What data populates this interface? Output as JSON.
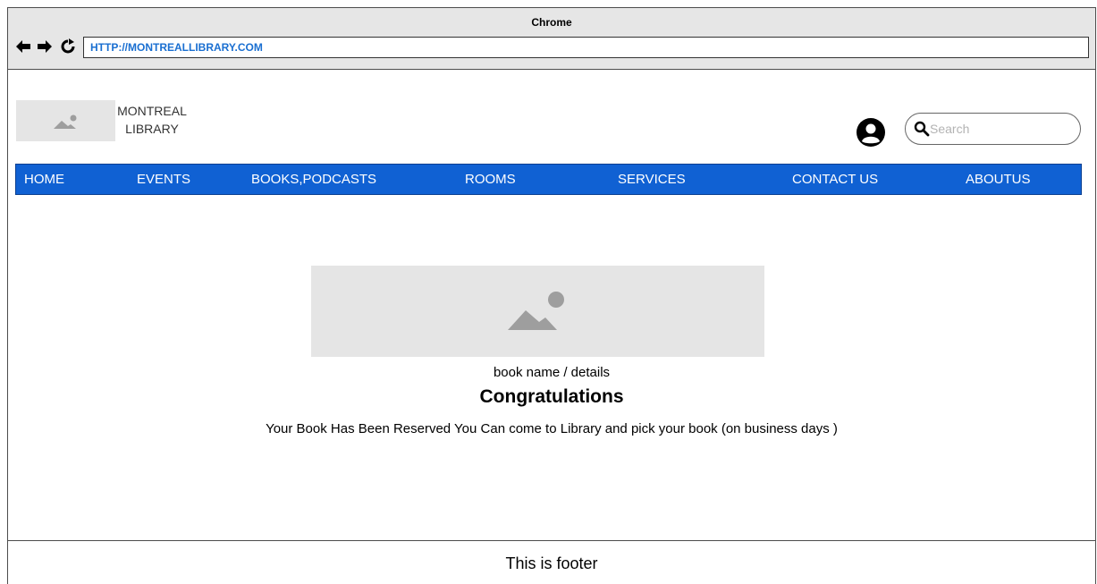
{
  "browser": {
    "title": "Chrome",
    "url": "HTTP://MONTREALLIBRARY.COM"
  },
  "header": {
    "logo_line1": "MONTREAL",
    "logo_line2": "LIBRARY",
    "search_placeholder": "Search"
  },
  "menu": {
    "items": [
      {
        "label": "HOME"
      },
      {
        "label": "EVENTS"
      },
      {
        "label": "BOOKS,PODCASTS"
      },
      {
        "label": "ROOMS"
      },
      {
        "label": "SERVICES"
      },
      {
        "label": "CONTACT US"
      },
      {
        "label": "ABOUTUS"
      }
    ]
  },
  "main": {
    "book_details": "book name / details",
    "heading": "Congratulations",
    "message": "Your Book Has Been Reserved You Can come to Library and pick your book (on business days )"
  },
  "footer": {
    "text": "This is footer"
  },
  "colors": {
    "menu_bg": "#1061d3",
    "url_text": "#1a6fd1",
    "placeholder_bg": "#e5e5e5"
  }
}
